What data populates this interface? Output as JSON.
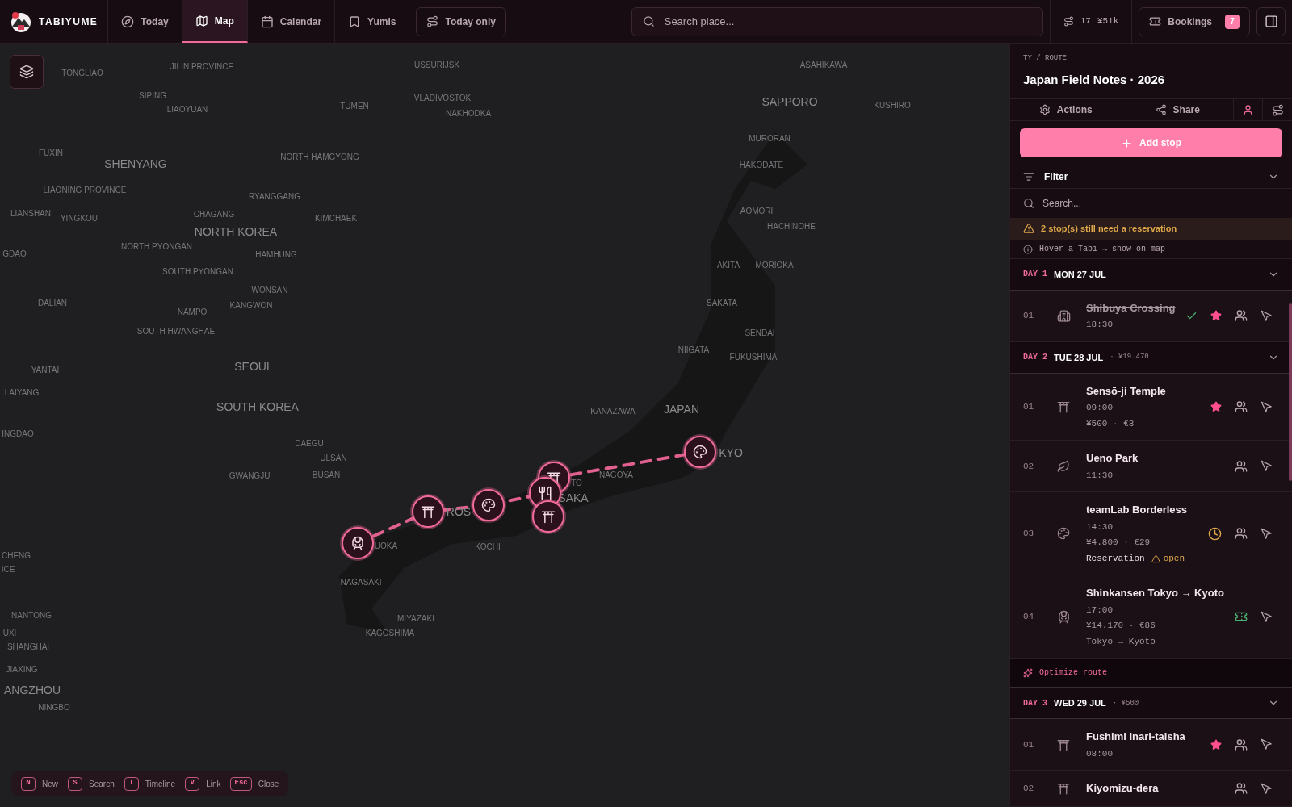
{
  "brand": {
    "name": "TABIYUME"
  },
  "nav": [
    {
      "kind": "today",
      "label": "Today",
      "selected": false
    },
    {
      "kind": "map",
      "label": "Map",
      "selected": true
    },
    {
      "kind": "calendar",
      "label": "Calendar",
      "selected": false
    },
    {
      "kind": "saved",
      "label": "Yumis",
      "selected": false
    }
  ],
  "filter_toggle": {
    "label": "Today only"
  },
  "search": {
    "placeholder": "Search place..."
  },
  "stats": {
    "stops": "17",
    "budget": "¥51k"
  },
  "bookings": {
    "label": "Bookings",
    "count": "7"
  },
  "map": {
    "labels": [
      "TONGLIAO",
      "JILIN PROVINCE",
      "USSURIJSK",
      "ASAHIKAWA",
      "SIPING",
      "VLADIVOSTOK",
      "SAPPORO",
      "KUSHIRO",
      "LIAOYUAN",
      "TUMEN",
      "NAKHODKA",
      "FUXIN",
      "NORTH HAMGYONG",
      "SHENYANG",
      "MURORAN",
      "HAKODATE",
      "LIAONING PROVINCE",
      "RYANGGANG",
      "LIANSHAN",
      "YINGKOU",
      "CHAGANG",
      "KIMCHAEK",
      "AOMORI",
      "HACHINOHE",
      "NORTH KOREA",
      "NORTH PYONGAN",
      "HAMHUNG",
      "GDAO",
      "SOUTH PYONGAN",
      "AKITA",
      "MORIOKA",
      "WONSAN",
      "KANGWON",
      "NAMPO",
      "DALIAN",
      "SAKATA",
      "SOUTH HWANGHAE",
      "SENDAI",
      "SEOUL",
      "NIIGATA",
      "FUKUSHIMA",
      "YANTAI",
      "LAIYANG",
      "SOUTH KOREA",
      "KANAZAWA",
      "JAPAN",
      "INGDAO",
      "DAEGU",
      "ULSAN",
      "GWANGJU",
      "BUSAN",
      "NAGOYA",
      "TO",
      "SAKA",
      "KYO",
      "ROS",
      "UOKA",
      "KOCHI",
      "NAGASAKI",
      "MIYAZAKI",
      "KAGOSHIMA",
      "CHENG",
      "ICE",
      "NANTONG",
      "UXI",
      "SHANGHAI",
      "JIAXING",
      "ANGZHOU",
      "NINGBO"
    ]
  },
  "shortcuts": [
    {
      "key": "N",
      "label": "New"
    },
    {
      "key": "S",
      "label": "Search"
    },
    {
      "key": "T",
      "label": "Timeline"
    },
    {
      "key": "V",
      "label": "Link"
    },
    {
      "key": "Esc",
      "label": "Close"
    }
  ],
  "panel": {
    "breadcrumb": "TY / ROUTE",
    "title": "Japan Field Notes · 2026",
    "actions": [
      {
        "kind": "settings",
        "label": "Actions"
      },
      {
        "kind": "share",
        "label": "Share"
      }
    ],
    "add_button": "Add stop",
    "filter": {
      "label": "Filter",
      "expanded": false
    },
    "search": {
      "placeholder": "Search..."
    },
    "warning": "2 stop(s) still need a reservation",
    "hint": "Hover a Tabi → show on map",
    "days": [
      {
        "day": "DAY 1",
        "date": "MON 27 JUL",
        "expanded": true,
        "stops": [
          {
            "num": "01",
            "kind": "building",
            "title": "Shibuya Crossing",
            "done": true,
            "time": "18:30",
            "starred": true,
            "confirmed": true,
            "awaiting_reservation": false,
            "ticketed": false
          }
        ]
      },
      {
        "day": "DAY 2",
        "date": "TUE 28 JUL",
        "cost": "· ¥19.470",
        "expanded": true,
        "stops": [
          {
            "num": "01",
            "kind": "shrine",
            "title": "Sensō-ji Temple",
            "done": false,
            "time": "09:00",
            "price": "¥500 · €3",
            "starred": true,
            "confirmed": false,
            "awaiting_reservation": false,
            "ticketed": false
          },
          {
            "num": "02",
            "kind": "park",
            "title": "Ueno Park",
            "done": false,
            "time": "11:30",
            "starred": false,
            "confirmed": false,
            "awaiting_reservation": false,
            "ticketed": false
          },
          {
            "num": "03",
            "kind": "art",
            "title": "teamLab Borderless",
            "done": false,
            "time": "14:30",
            "price": "¥4.800 · €29",
            "reservation": {
              "label": "Reservation",
              "status": "open"
            },
            "starred": false,
            "confirmed": false,
            "awaiting_reservation": true,
            "ticketed": false
          },
          {
            "num": "04",
            "kind": "train",
            "title": "Shinkansen Tokyo → Kyoto",
            "done": false,
            "time": "17:00",
            "price": "¥14.170 · €86",
            "note": "Tokyo → Kyoto",
            "starred": false,
            "confirmed": false,
            "awaiting_reservation": false,
            "ticketed": true
          }
        ],
        "footer": "Optimize route"
      },
      {
        "day": "DAY 3",
        "date": "WED 29 JUL",
        "cost": "· ¥500",
        "expanded": true,
        "stops": [
          {
            "num": "01",
            "kind": "shrine",
            "title": "Fushimi Inari-taisha",
            "done": false,
            "time": "08:00",
            "starred": true,
            "confirmed": false,
            "awaiting_reservation": false,
            "ticketed": false
          },
          {
            "num": "02",
            "kind": "shrine",
            "title": "Kiyomizu-dera",
            "done": false,
            "starred": false,
            "confirmed": false,
            "awaiting_reservation": false,
            "ticketed": false
          }
        ]
      }
    ]
  }
}
